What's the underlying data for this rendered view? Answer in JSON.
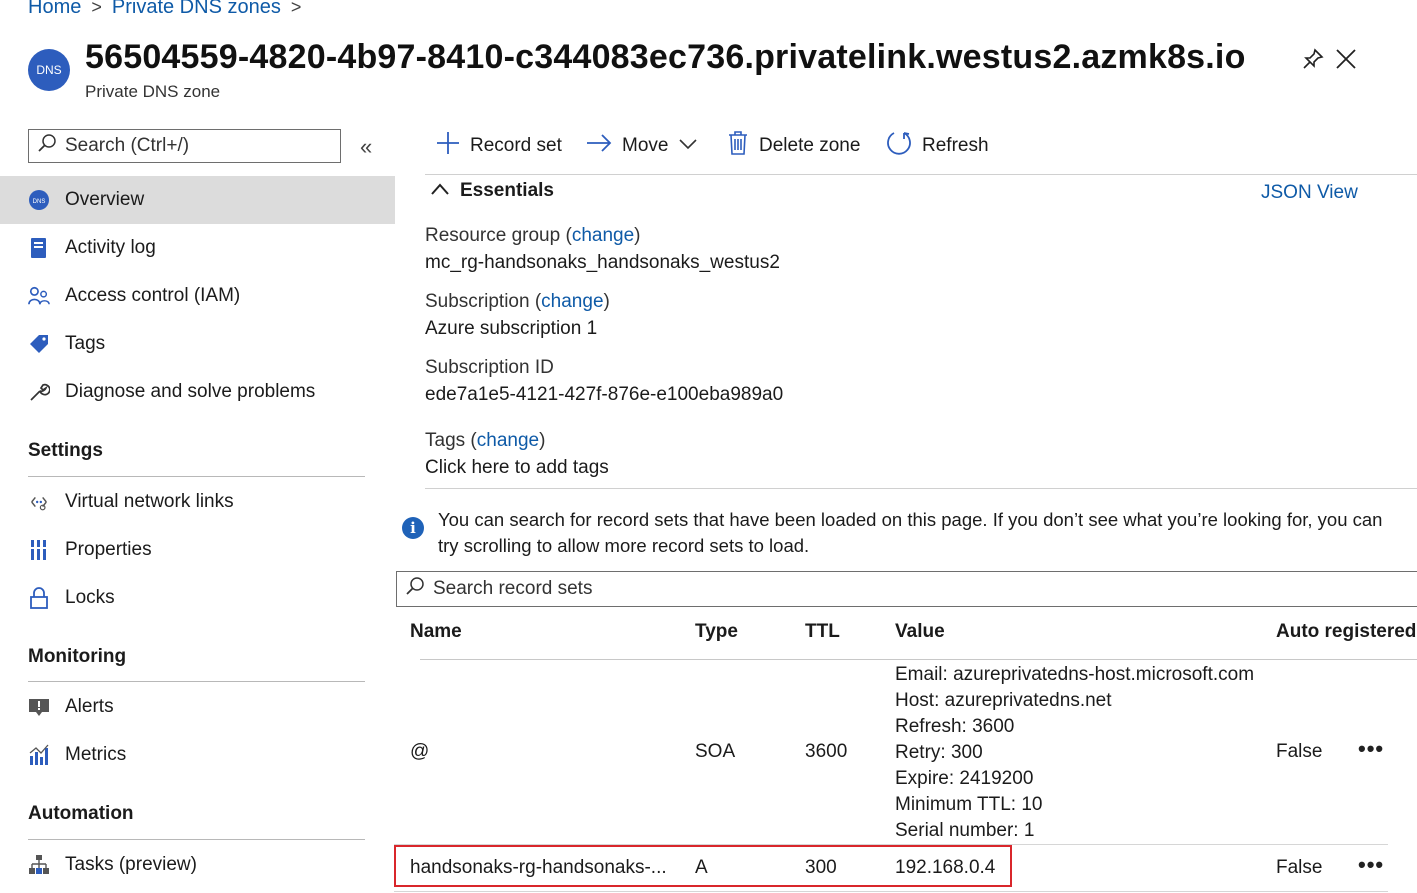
{
  "breadcrumb": {
    "home": "Home",
    "parent": "Private DNS zones"
  },
  "resource": {
    "icon_text": "DNS",
    "title": "56504559-4820-4b97-8410-c344083ec736.privatelink.westus2.azmk8s.io",
    "subtitle": "Private DNS zone"
  },
  "sidebar": {
    "search_placeholder": "Search (Ctrl+/)",
    "collapse_glyph": "«",
    "items": [
      {
        "label": "Overview"
      },
      {
        "label": "Activity log"
      },
      {
        "label": "Access control (IAM)"
      },
      {
        "label": "Tags"
      },
      {
        "label": "Diagnose and solve problems"
      }
    ],
    "settings_title": "Settings",
    "settings": [
      {
        "label": "Virtual network links"
      },
      {
        "label": "Properties"
      },
      {
        "label": "Locks"
      }
    ],
    "monitoring_title": "Monitoring",
    "monitoring": [
      {
        "label": "Alerts"
      },
      {
        "label": "Metrics"
      }
    ],
    "automation_title": "Automation",
    "automation": [
      {
        "label": "Tasks (preview)"
      }
    ]
  },
  "toolbar": {
    "record_set": "Record set",
    "move": "Move",
    "delete_zone": "Delete zone",
    "refresh": "Refresh"
  },
  "essentials": {
    "title": "Essentials",
    "json_view": "JSON View",
    "change": "change",
    "resource_group_label": "Resource group",
    "resource_group_value": "mc_rg-handsonaks_handsonaks_westus2",
    "subscription_label": "Subscription",
    "subscription_value": "Azure subscription 1",
    "subscription_id_label": "Subscription ID",
    "subscription_id_value": "ede7a1e5-4121-427f-876e-e100eba989a0",
    "tags_label": "Tags",
    "tags_value": "Click here to add tags"
  },
  "info": {
    "text": "You can search for record sets that have been loaded on this page. If you don’t see what you’re looking for, you can try scrolling to allow more record sets to load."
  },
  "record_search": {
    "placeholder": "Search record sets"
  },
  "table": {
    "headers": {
      "name": "Name",
      "type": "Type",
      "ttl": "TTL",
      "value": "Value",
      "auto": "Auto registered"
    },
    "rows": [
      {
        "name": "@",
        "type": "SOA",
        "ttl": "3600",
        "value_lines": [
          "Email: azureprivatedns-host.microsoft.com",
          "Host: azureprivatedns.net",
          "Refresh: 3600",
          "Retry: 300",
          "Expire: 2419200",
          "Minimum TTL: 10",
          "Serial number: 1"
        ],
        "auto": "False",
        "more": "•••"
      },
      {
        "name": "handsonaks-rg-handsonaks-...",
        "type": "A",
        "ttl": "300",
        "value": "192.168.0.4",
        "auto": "False",
        "more": "•••"
      }
    ]
  },
  "colors": {
    "link": "#0e5aa7",
    "highlight_border": "#d9262b",
    "active_nav": "#dcdcdc"
  }
}
